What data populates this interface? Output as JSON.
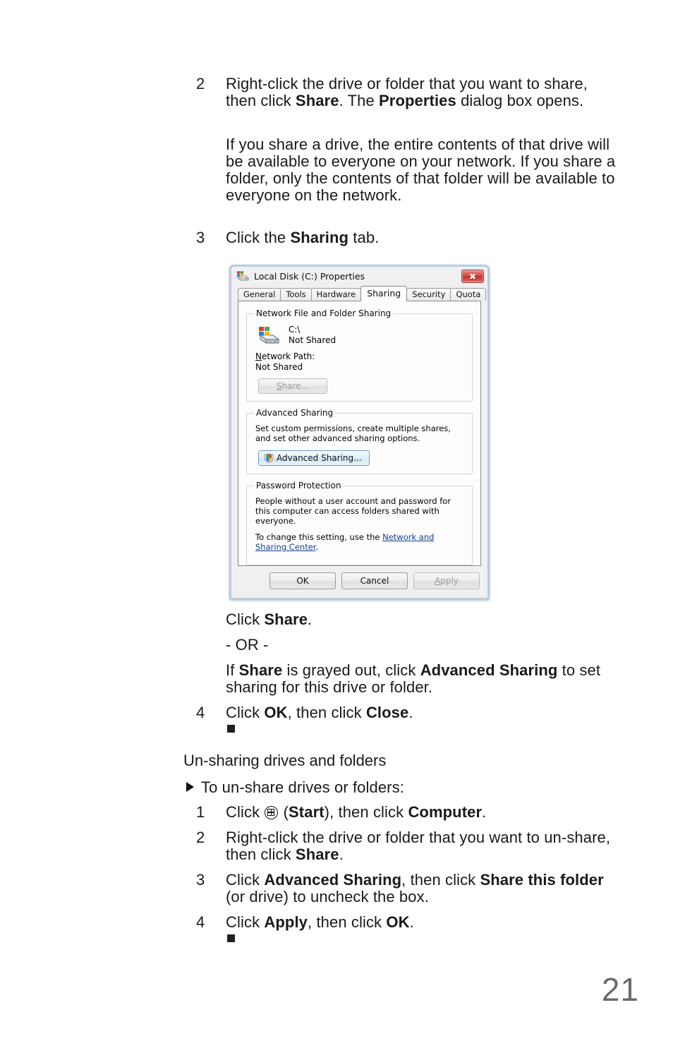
{
  "document": {
    "page_number": "21"
  },
  "steps_share": [
    {
      "num": "2",
      "html": "Right-click the drive or folder that you want to share, then click <b>Share</b>. The <b>Properties</b> dialog box opens."
    },
    {
      "num": "",
      "html": "If you share a drive, the entire contents of that drive will be available to everyone on your network. If you share a folder, only the contents of that folder will be available to everyone on the network."
    },
    {
      "num": "3",
      "html": "Click the <b>Sharing</b> tab."
    }
  ],
  "after_dialog": {
    "click_share": "Click <b>Share</b>.",
    "or": "- OR -",
    "grayed_out": "If <b>Share</b> is grayed out, click <b>Advanced Sharing</b> to set sharing for this drive or folder.",
    "step4_num": "4",
    "step4": "Click <b>OK</b>, then click <b>Close</b>."
  },
  "unsharing": {
    "heading": "Un-sharing drives and folders",
    "intro": "To un-share drives or folders:",
    "steps": [
      {
        "num": "1",
        "html": "Click <span class=\"start-glyph\" data-name=\"start-button-icon\"><i></i></span> (<b>Start</b>), then click <b>Computer</b>."
      },
      {
        "num": "2",
        "html": "Right-click the drive or folder that you want to un-share, then click <b>Share</b>."
      },
      {
        "num": "3",
        "html": "Click <b>Advanced Sharing</b>, then click <b>Share this folder</b> (or drive) to uncheck the box."
      },
      {
        "num": "4",
        "html": "Click <b>Apply</b>, then click <b>OK</b>."
      }
    ]
  },
  "dialog": {
    "title": "Local Disk (C:) Properties",
    "close_label": "✖",
    "tabs": [
      {
        "label": "General",
        "active": false
      },
      {
        "label": "Tools",
        "active": false
      },
      {
        "label": "Hardware",
        "active": false
      },
      {
        "label": "Sharing",
        "active": true
      },
      {
        "label": "Security",
        "active": false
      },
      {
        "label": "Quota",
        "active": false
      }
    ],
    "network_sharing": {
      "legend": "Network File and Folder Sharing",
      "drive_name": "C:\\",
      "drive_status": "Not Shared",
      "network_path_label": "Network Path:",
      "network_path_value": "Not Shared",
      "share_button": "Share..."
    },
    "advanced_sharing": {
      "legend": "Advanced Sharing",
      "description": "Set custom permissions, create multiple shares, and set other advanced sharing options.",
      "button": "Advanced Sharing..."
    },
    "password_protection": {
      "legend": "Password Protection",
      "description": "People without a user account and password for this computer can access folders shared with everyone.",
      "change_prefix": "To change this setting, use the ",
      "link": "Network and Sharing Center",
      "change_suffix": "."
    },
    "buttons": {
      "ok": "OK",
      "cancel": "Cancel",
      "apply": "Apply"
    }
  }
}
